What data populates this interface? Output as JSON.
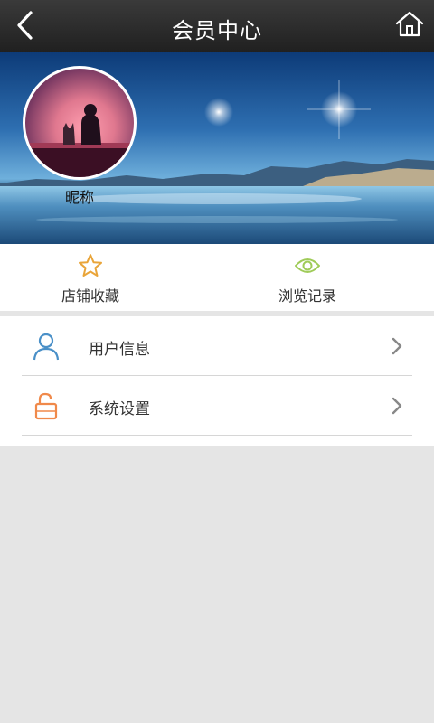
{
  "header": {
    "title": "会员中心",
    "back_icon": "chevron-left-icon",
    "home_icon": "home-icon"
  },
  "profile": {
    "nickname": "昵称"
  },
  "quick_links": [
    {
      "label": "店铺收藏",
      "icon": "star-icon",
      "color": "#e9a53a"
    },
    {
      "label": "浏览记录",
      "icon": "eye-icon",
      "color": "#9fcb58"
    }
  ],
  "menu": [
    {
      "label": "用户信息",
      "icon": "user-icon",
      "color": "#4a90c8"
    },
    {
      "label": "系统设置",
      "icon": "unlock-icon",
      "color": "#f0894a"
    }
  ]
}
